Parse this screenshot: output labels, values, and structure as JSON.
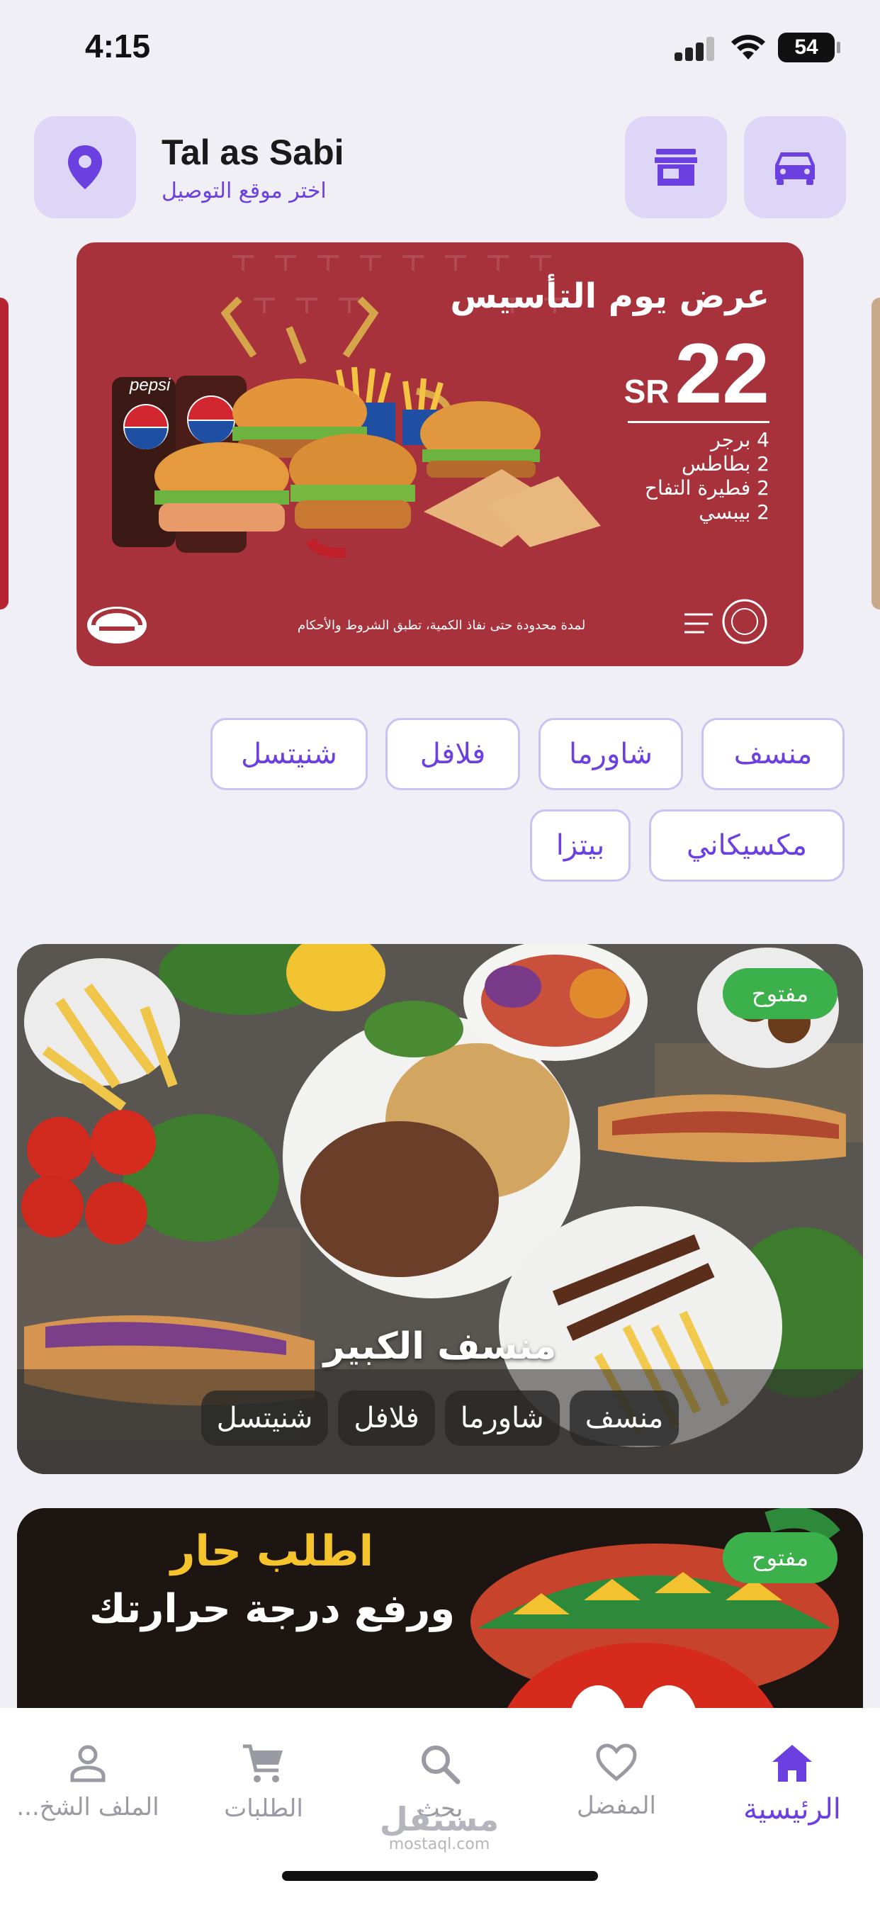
{
  "status_bar": {
    "time": "4:15",
    "battery": "54"
  },
  "header": {
    "location_title": "Tal as Sabi",
    "location_subtitle": "اختر موقع التوصيل"
  },
  "banner": {
    "title": "عرض يوم التأسيس",
    "price": "22",
    "currency": "SR",
    "items": [
      "4 برجر",
      "2 بطاطس",
      "2 فطيرة التفاح",
      "2 بيبسي"
    ],
    "drink_label": "pepsi",
    "footer": "لمدة محدودة حتى نفاذ الكمية، تطبق الشروط والأحكام"
  },
  "categories": [
    "منسف",
    "شاورما",
    "فلافل",
    "شنيتسل",
    "مكسيكاني",
    "بيتزا"
  ],
  "restaurants": [
    {
      "name": "منسف الكبير",
      "status": "مفتوح",
      "tags": [
        "منسف",
        "شاورما",
        "فلافل",
        "شنيتسل"
      ]
    },
    {
      "status": "مفتوح",
      "promo_line1": "اطلب حار",
      "promo_line2": "ورفع درجة حرارتك"
    }
  ],
  "bottom_nav": [
    {
      "label": "الرئيسية",
      "icon": "home-icon",
      "active": true
    },
    {
      "label": "المفضل",
      "icon": "heart-icon",
      "active": false
    },
    {
      "label": "بحث",
      "icon": "search-icon",
      "active": false
    },
    {
      "label": "الطلبات",
      "icon": "cart-icon",
      "active": false
    },
    {
      "label": "الملف الشخ...",
      "icon": "profile-icon",
      "active": false
    }
  ],
  "watermark": {
    "arabic": "مستقل",
    "latin": "mostaql.com"
  },
  "colors": {
    "accent": "#6c3fe0",
    "accent_light": "#ddd6f7",
    "open_green": "#3cb04a",
    "banner_red": "#a8323c"
  }
}
